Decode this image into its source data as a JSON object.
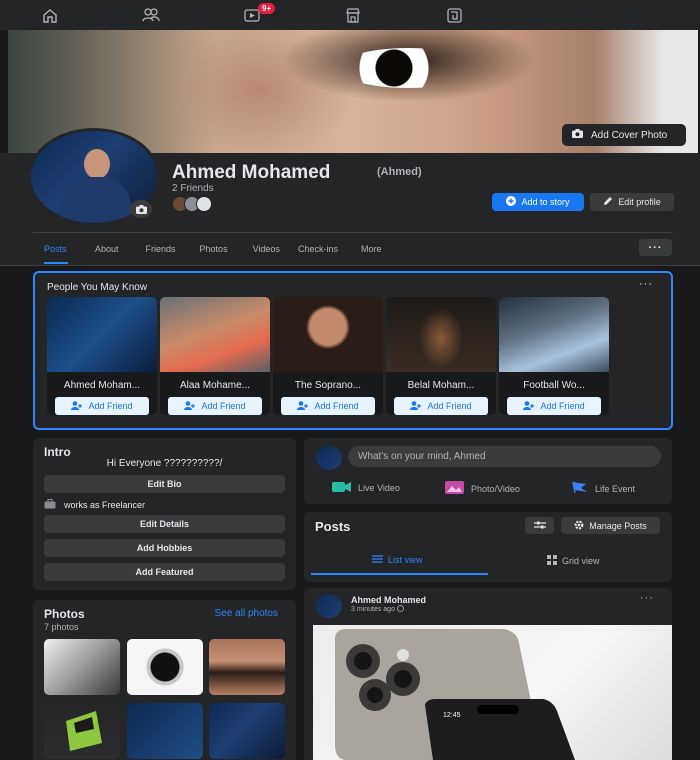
{
  "nav": {
    "icons": [
      "home-icon",
      "friends-icon",
      "watch-icon",
      "marketplace-icon",
      "gaming-icon"
    ],
    "watch_badge": "9+"
  },
  "cover": {
    "add_cover_label": "Add Cover Photo"
  },
  "profile": {
    "name": "Ahmed Mohamed",
    "alt_name": "(Ahmed)",
    "friends_count": "2 Friends",
    "add_story_label": "Add to story",
    "edit_profile_label": "Edit profile"
  },
  "tabs": [
    "Posts",
    "About",
    "Friends",
    "Photos",
    "Videos",
    "Check-ins",
    "More"
  ],
  "pymk": {
    "title": "People You May Know",
    "add_friend_label": "Add Friend",
    "people": [
      {
        "name": "Ahmed Moham..."
      },
      {
        "name": "Alaa Mohame..."
      },
      {
        "name": "The Soprano..."
      },
      {
        "name": "Belal Moham..."
      },
      {
        "name": "Football Wo..."
      }
    ]
  },
  "intro": {
    "title": "Intro",
    "bio": "Hi Everyone ??????????/",
    "edit_bio": "Edit Bio",
    "work": "works as Freelancer",
    "edit_details": "Edit Details",
    "add_hobbies": "Add Hobbies",
    "add_featured": "Add Featured"
  },
  "photos": {
    "title": "Photos",
    "see_all": "See all photos",
    "count": "7 photos"
  },
  "composer": {
    "placeholder": "What's on your mind, Ahmed",
    "live_video": "Live Video",
    "photo_video": "Photo/Video",
    "life_event": "Life Event"
  },
  "posts": {
    "title": "Posts",
    "manage_label": "Manage Posts",
    "list_view": "List view",
    "grid_view": "Grid view"
  },
  "post": {
    "author": "Ahmed Mohamed",
    "time": "3 minutes ago",
    "phone_time": "12:45"
  },
  "colors": {
    "accent": "#1877f2",
    "active_tab": "#2d88ff",
    "panel": "#242526",
    "bg": "#18191a"
  }
}
